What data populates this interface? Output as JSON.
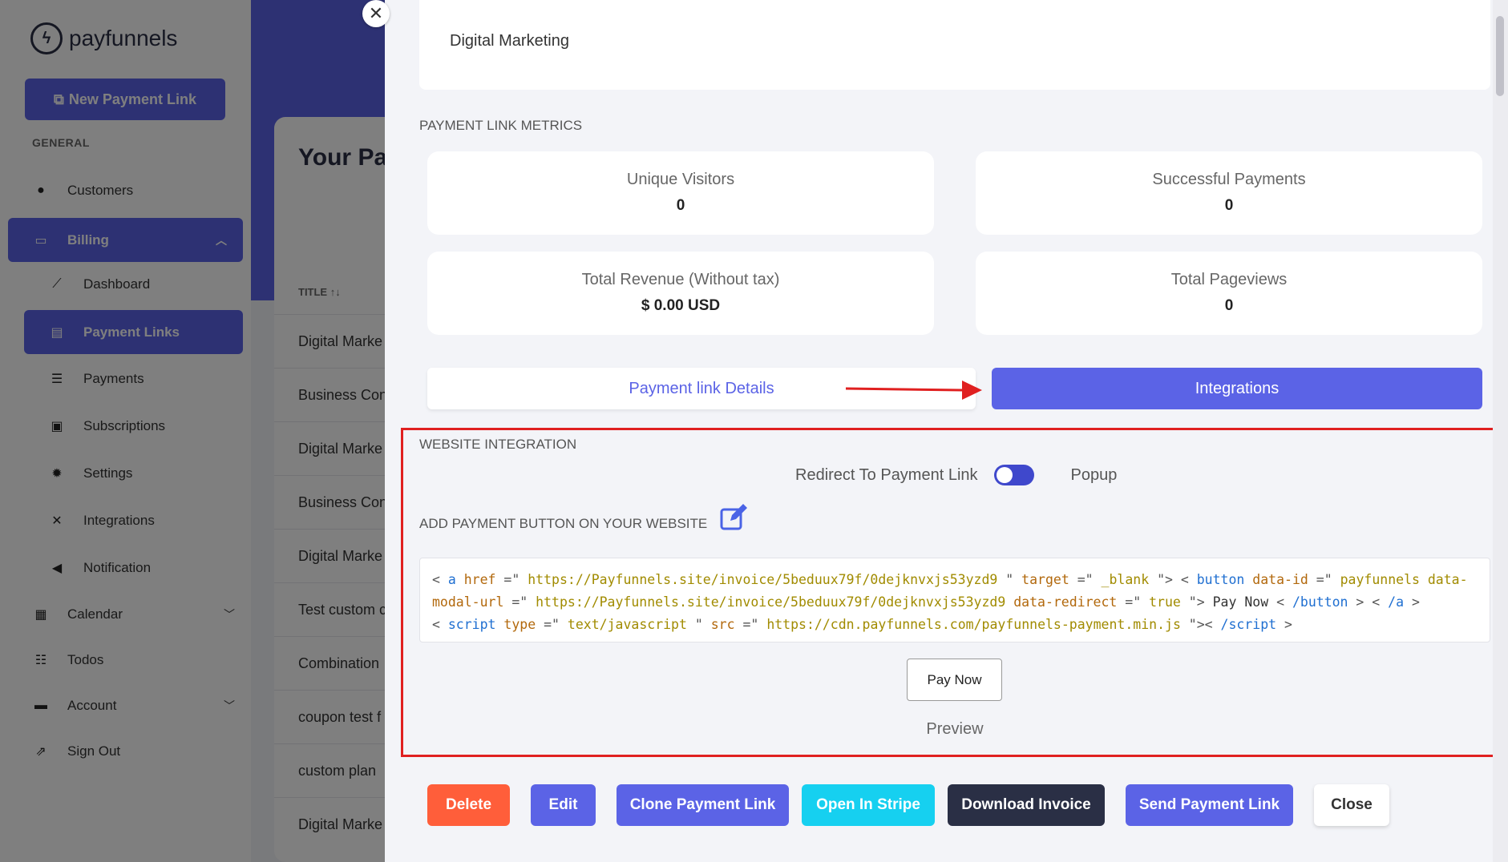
{
  "sidebar": {
    "logo_text": "payfunnels",
    "new_link_label": "New Payment Link",
    "section_label": "GENERAL",
    "items": [
      {
        "label": "Customers",
        "icon": "user-icon"
      },
      {
        "label": "Billing",
        "icon": "money-icon"
      },
      {
        "label": "Dashboard",
        "icon": "chart-icon"
      },
      {
        "label": "Payment Links",
        "icon": "link-list-icon"
      },
      {
        "label": "Payments",
        "icon": "payments-icon"
      },
      {
        "label": "Subscriptions",
        "icon": "subscriptions-icon"
      },
      {
        "label": "Settings",
        "icon": "gear-icon"
      },
      {
        "label": "Integrations",
        "icon": "tools-icon"
      },
      {
        "label": "Notification",
        "icon": "megaphone-icon"
      },
      {
        "label": "Calendar",
        "icon": "calendar-icon"
      },
      {
        "label": "Todos",
        "icon": "list-icon"
      },
      {
        "label": "Account",
        "icon": "id-card-icon"
      },
      {
        "label": "Sign Out",
        "icon": "runner-icon"
      }
    ]
  },
  "background": {
    "title": "Your Pay",
    "column_header": "TITLE ↑↓",
    "rows": [
      "Digital Marke",
      "Business Con",
      "Digital Marke",
      "Business Con",
      "Digital Marke",
      "Test custom c",
      "Combination",
      "coupon test f",
      "custom plan",
      "Digital Marke"
    ]
  },
  "drawer": {
    "link_title": "Digital Marketing",
    "metrics_heading": "PAYMENT LINK METRICS",
    "metrics": {
      "unique_visitors": {
        "label": "Unique Visitors",
        "value": "0"
      },
      "successful_payments": {
        "label": "Successful Payments",
        "value": "0"
      },
      "total_revenue": {
        "label": "Total Revenue (Without tax)",
        "value": "$ 0.00 USD"
      },
      "total_pageviews": {
        "label": "Total Pageviews",
        "value": "0"
      }
    },
    "tabs": {
      "details": "Payment link Details",
      "integrations": "Integrations"
    },
    "integration": {
      "heading": "WEBSITE INTEGRATION",
      "toggle_left": "Redirect To Payment Link",
      "toggle_right": "Popup",
      "add_button_heading": "ADD PAYMENT BUTTON ON YOUR WEBSITE",
      "code": {
        "invoice_url": "https://Payfunnels.site/invoice/5beduux79f/0dejknvxjs53yzd9",
        "target": "_blank",
        "data_id": "payfunnels data-",
        "modal_url_attr": "modal-url",
        "redirect": "true",
        "button_text": "Pay Now",
        "script_type": "text/javascript",
        "script_src": "https://cdn.payfunnels.com/payfunnels-payment.min.js"
      },
      "preview_button": "Pay Now",
      "preview_label": "Preview"
    },
    "actions": {
      "delete": "Delete",
      "edit": "Edit",
      "clone": "Clone Payment Link",
      "stripe": "Open In Stripe",
      "download": "Download Invoice",
      "send": "Send Payment Link",
      "close": "Close"
    },
    "colors": {
      "primary": "#5b63e6",
      "delete": "#ff5e3a",
      "stripe": "#16d0f0",
      "dark": "#2a2f45",
      "highlight": "#e02020"
    }
  }
}
